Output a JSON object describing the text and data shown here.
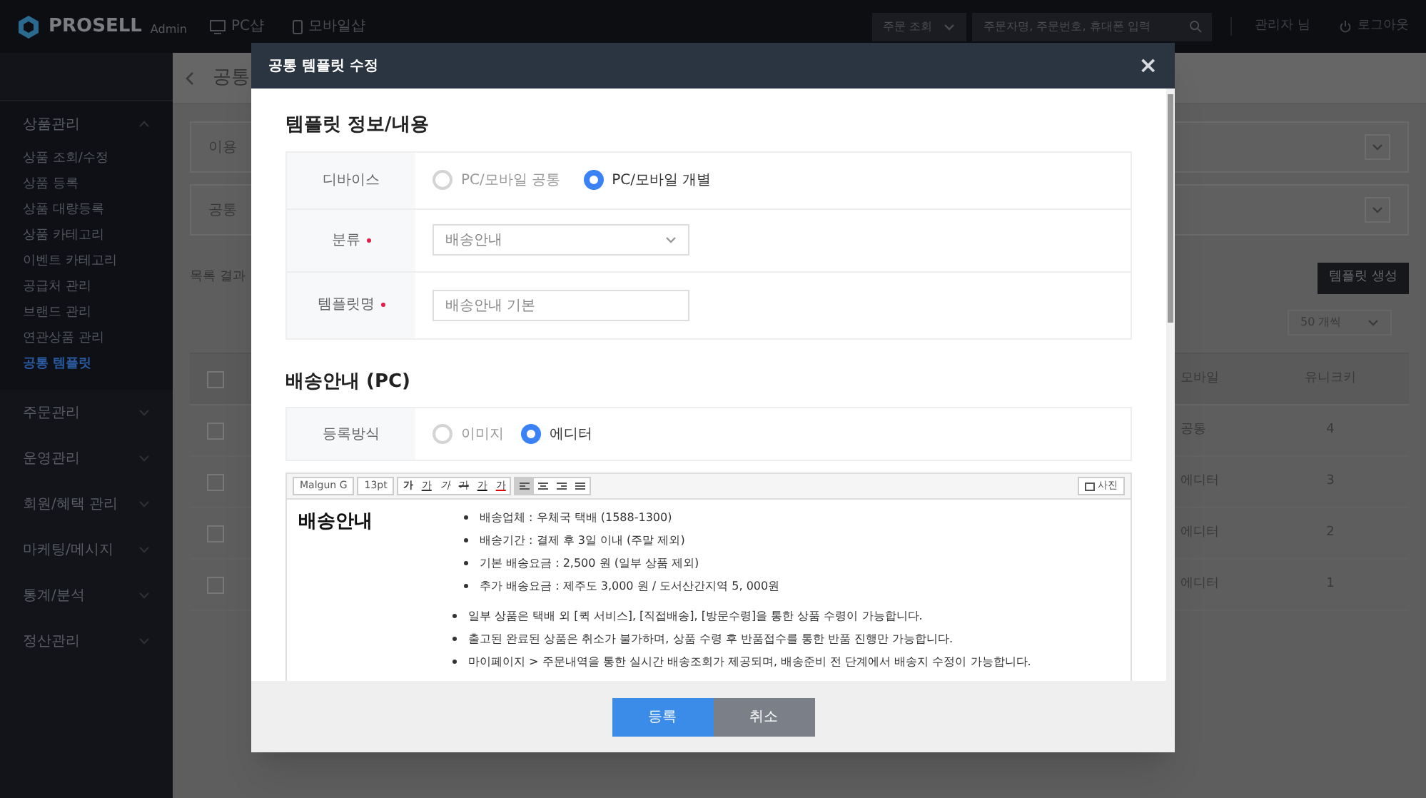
{
  "topbar": {
    "logo": "PROSELL",
    "logo_sub": "Admin",
    "links": [
      "PC샵",
      "모바일샵"
    ],
    "search_type": "주문 조회",
    "search_placeholder": "주문자명, 주문번호, 휴대폰 입력",
    "user": "관리자 님",
    "logout": "로그아웃"
  },
  "sidebar": {
    "groups": [
      {
        "label": "상품관리",
        "expanded": true,
        "children": [
          {
            "label": "상품 조회/수정",
            "selected": false
          },
          {
            "label": "상품 등록",
            "selected": false
          },
          {
            "label": "상품 대량등록",
            "selected": false
          },
          {
            "label": "상품 카테고리",
            "selected": false
          },
          {
            "label": "이벤트 카테고리",
            "selected": false
          },
          {
            "label": "공급처 관리",
            "selected": false
          },
          {
            "label": "브랜드 관리",
            "selected": false
          },
          {
            "label": "연관상품 관리",
            "selected": false
          },
          {
            "label": "공통 템플릿",
            "selected": true
          }
        ]
      },
      {
        "label": "주문관리",
        "expanded": false
      },
      {
        "label": "운영관리",
        "expanded": false
      },
      {
        "label": "회원/혜택 관리",
        "expanded": false
      },
      {
        "label": "마케팅/메시지",
        "expanded": false
      },
      {
        "label": "통계/분석",
        "expanded": false
      },
      {
        "label": "정산관리",
        "expanded": false
      }
    ]
  },
  "page": {
    "title": "공통",
    "filters": [
      "이용",
      "공통"
    ],
    "result_label": "목록 결과",
    "create_button": "템플릿 생성",
    "page_size": "50 개씩",
    "all_checked": false,
    "columns": [
      "모바일",
      "유니크키"
    ],
    "rows": [
      {
        "checked": false,
        "column_1": "공통",
        "column_2": "4"
      },
      {
        "checked": false,
        "column_1": "에디터",
        "column_2": "3"
      },
      {
        "checked": false,
        "column_1": "에디터",
        "column_2": "2"
      },
      {
        "checked": false,
        "column_1": "에디터",
        "column_2": "1"
      }
    ]
  },
  "modal": {
    "title": "공통 템플릿 수정",
    "close": "×",
    "section_1": {
      "title": "템플릿 정보/내용",
      "device": {
        "label": "디바이스",
        "options": [
          {
            "label": "PC/모바일 공통",
            "selected": false
          },
          {
            "label": "PC/모바일 개별",
            "selected": true
          }
        ]
      },
      "category": {
        "label": "분류",
        "required": true,
        "value": "배송안내"
      },
      "name": {
        "label": "템플릿명",
        "required": true,
        "value": "배송안내 기본"
      }
    },
    "section_2": {
      "title": "배송안내 (PC)",
      "method": {
        "label": "등록방식",
        "options": [
          {
            "label": "이미지",
            "selected": false
          },
          {
            "label": "에디터",
            "selected": true
          }
        ]
      },
      "editor": {
        "font": "Malgun G",
        "size": "13pt",
        "format_buttons": [
          {
            "label": "가",
            "kind": "bold"
          },
          {
            "label": "가",
            "kind": "underline"
          },
          {
            "label": "가",
            "kind": "italic"
          },
          {
            "label": "가",
            "kind": "strike"
          },
          {
            "label": "가",
            "kind": "color"
          },
          {
            "label": "가",
            "kind": "highlight"
          }
        ],
        "alignments": [
          {
            "selected": true
          },
          {
            "selected": false
          },
          {
            "selected": false
          },
          {
            "selected": false
          }
        ],
        "photo": "사진",
        "heading": "배송안내",
        "info": [
          "배송업체 : 우체국 택배 (1588-1300)",
          "배송기간 : 결제 후 3일 이내 (주말 제외)",
          "기본 배송요금 : 2,500 원 (일부 상품 제외)",
          "추가 배송요금 : 제주도 3,000 원 / 도서산간지역 5, 000원"
        ],
        "notes": [
          "일부 상품은 택배 외 [퀵 서비스], [직접배송], [방문수령]을 통한 상품 수령이 가능합니다.",
          "출고된 완료된 상품은 취소가 불가하며, 상품 수령 후 반품접수를 통한 반품 진행만 가능합니다.",
          "마이페이지 > 주문내역을 통한 실시간 배송조회가 제공되며, 배송준비 전 단계에서 배송지 수정이 가능합니다."
        ]
      }
    },
    "buttons": [
      {
        "label": "등록",
        "kind": "primary"
      },
      {
        "label": "취소",
        "kind": "secondary"
      }
    ]
  }
}
